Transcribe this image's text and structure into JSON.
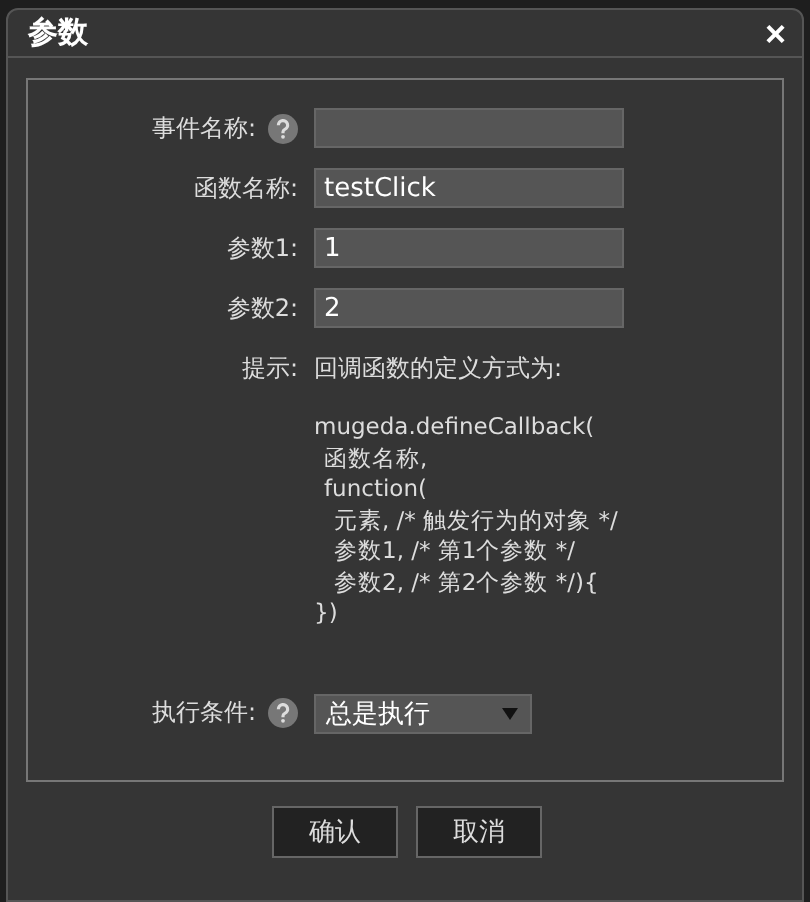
{
  "dialog": {
    "title": "参数",
    "close": "×"
  },
  "fields": [
    {
      "label": "事件名称:",
      "help": true
    },
    {
      "label": "函数名称:",
      "help": false,
      "value": "testClick"
    },
    {
      "label": "参数1:",
      "help": false,
      "value": "1"
    },
    {
      "label": "参数2:",
      "help": false,
      "value": "2"
    }
  ],
  "hint": {
    "label": "提示:",
    "text": "回调函数的定义方式为:",
    "code": [
      {
        "text": "mugeda.defineCallback(",
        "children": [
          {
            "text": "函数名称,"
          },
          {
            "text": "function(",
            "children": [
              {
                "text": "元素, /* 触发行为的对象 */"
              },
              {
                "text": "参数1, /* 第1个参数 */"
              },
              {
                "text": "参数2, /* 第2个参数 */){"
              }
            ]
          }
        ]
      },
      {
        "text": "})"
      }
    ]
  },
  "condition": {
    "label": "执行条件:",
    "help": true,
    "value": "总是执行"
  },
  "buttons": [
    "确认",
    "取消"
  ]
}
